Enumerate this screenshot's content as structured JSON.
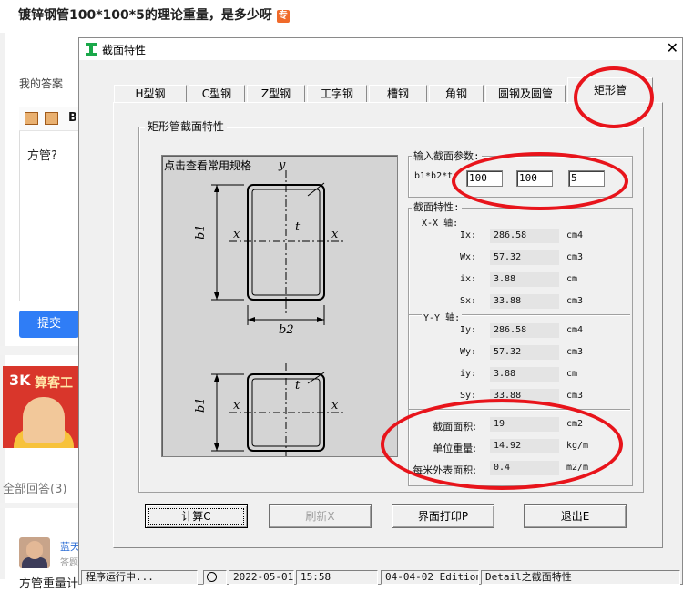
{
  "page": {
    "question_title": "镀锌钢管100*100*5的理论重量，是多少呀",
    "question_tag": "专",
    "my_answer_label": "我的答案",
    "editor_bold": "B",
    "answer_text": "方管?",
    "submit_label": "提交",
    "banner_logo": "3K",
    "banner_text": "算客工",
    "all_answers": "全部回答(3)",
    "user_name": "蓝天",
    "user_sub": "答题",
    "bottom_text": "方管重量计"
  },
  "dialog": {
    "title": "截面特性",
    "tabs": [
      {
        "label": "H型钢"
      },
      {
        "label": "C型钢"
      },
      {
        "label": "Z型钢"
      },
      {
        "label": "工字钢"
      },
      {
        "label": "槽钢"
      },
      {
        "label": "角钢"
      },
      {
        "label": "圆钢及圆管"
      },
      {
        "label": "矩形管",
        "active": true
      }
    ],
    "group_title": "矩形管截面特性",
    "drawing_caption": "点击查看常用规格",
    "drawing_labels": {
      "y": "y",
      "x": "x",
      "b1": "b1",
      "b2": "b2",
      "t": "t"
    },
    "inputs": {
      "label": "输入截面参数:",
      "dims_label": "b1*b2*t",
      "b1": "100",
      "b2": "100",
      "t": "5"
    },
    "properties": {
      "label": "截面特性:",
      "xx_axis": "X-X 轴:",
      "yy_axis": "Y-Y 轴:",
      "xx": [
        {
          "name": "Ix:",
          "value": "286.58",
          "unit": "cm4"
        },
        {
          "name": "Wx:",
          "value": "57.32",
          "unit": "cm3"
        },
        {
          "name": "ix:",
          "value": "3.88",
          "unit": "cm"
        },
        {
          "name": "Sx:",
          "value": "33.88",
          "unit": "cm3"
        }
      ],
      "yy": [
        {
          "name": "Iy:",
          "value": "286.58",
          "unit": "cm4"
        },
        {
          "name": "Wy:",
          "value": "57.32",
          "unit": "cm3"
        },
        {
          "name": "iy:",
          "value": "3.88",
          "unit": "cm"
        },
        {
          "name": "Sy:",
          "value": "33.88",
          "unit": "cm3"
        }
      ],
      "area": {
        "name": "截面面积:",
        "value": "19",
        "unit": "cm2"
      },
      "unit_weight": {
        "name": "单位重量:",
        "value": "14.92",
        "unit": "kg/m"
      },
      "surface_area": {
        "name": "每米外表面积:",
        "value": "0.4",
        "unit": "m2/m"
      }
    },
    "buttons": {
      "calc": "计算C",
      "refresh": "刷新X",
      "print": "界面打印P",
      "exit": "退出E"
    },
    "status": {
      "state": "程序运行中...",
      "date": "2022-05-01",
      "time": "15:58",
      "edition": "04-04-02 Edition",
      "detail": "Detail之截面特性"
    }
  },
  "colors": {
    "annotation": "#e8141b",
    "submit": "#2f7df6",
    "app_icon": "#1aa84a"
  }
}
